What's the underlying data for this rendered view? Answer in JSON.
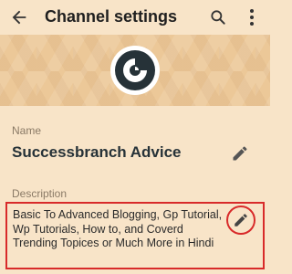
{
  "appbar": {
    "title": "Channel settings",
    "back_icon": "arrow-left-icon",
    "search_icon": "search-icon",
    "more_icon": "more-vertical-icon"
  },
  "channel": {
    "avatar_icon": "channel-logo",
    "name_label": "Name",
    "name_value": "Successbranch Advice",
    "description_label": "Description",
    "description_value": "Basic To Advanced Blogging, Gp Tutorial, Wp Tutorials,  How to, and Coverd Trending Topices or Much More in Hindi"
  },
  "colors": {
    "background": "#f8e4c8",
    "banner": "#ecc898",
    "highlight": "#d82a2a",
    "logo_dark": "#263238"
  }
}
